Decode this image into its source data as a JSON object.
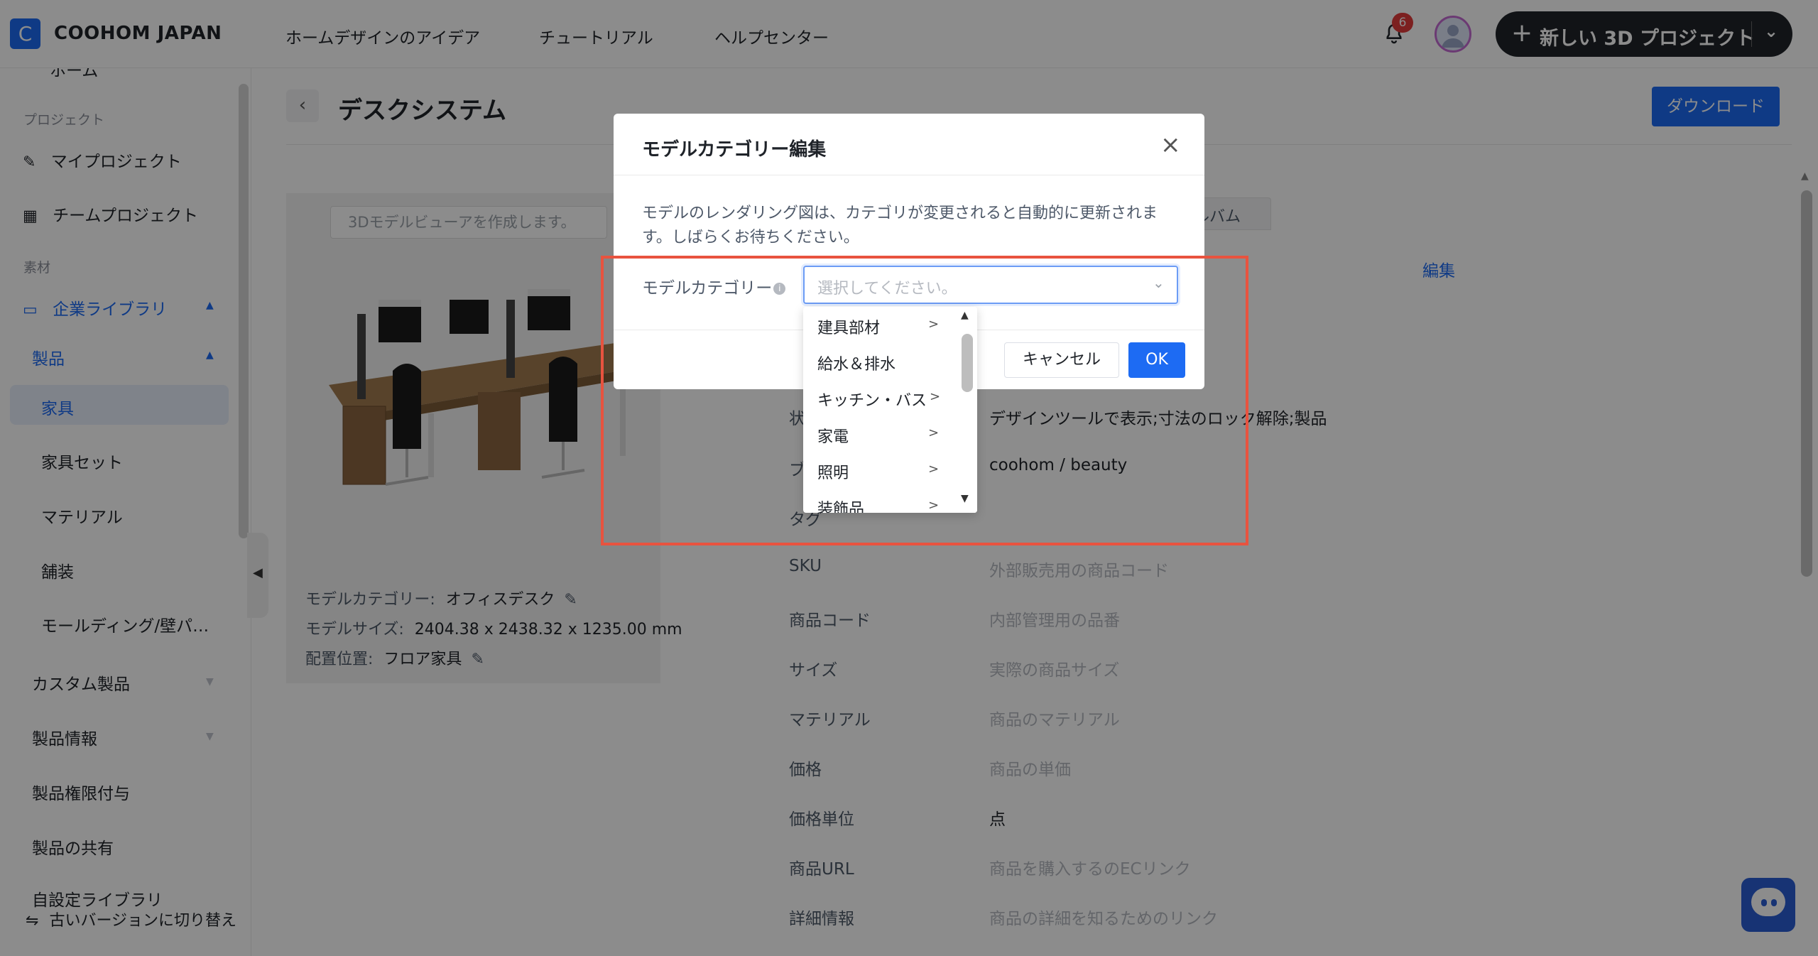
{
  "header": {
    "brand": "COOHOM JAPAN",
    "logo_letter": "C",
    "nav": [
      "ホームデザインのアイデア",
      "チュートリアル",
      "ヘルプセンター"
    ],
    "notification_count": "6",
    "new_project_label": "新しい 3D プロジェクト"
  },
  "sidebar": {
    "partial_top": "ホーム",
    "section_project": "プロジェクト",
    "my_projects": "マイプロジェクト",
    "team_projects": "チームプロジェクト",
    "section_material": "素材",
    "enterprise_library": "企業ライブラリ",
    "products": "製品",
    "furniture": "家具",
    "furniture_set": "家具セット",
    "material": "マテリアル",
    "flooring": "舗装",
    "molding": "モールディング/壁パ…",
    "custom_products": "カスタム製品",
    "product_info": "製品情報",
    "product_permission": "製品権限付与",
    "product_share": "製品の共有",
    "partial_bottom": "自設定ライブラリ",
    "switch_old": "古いバージョンに切り替え"
  },
  "page": {
    "title": "デスクシステム",
    "download": "ダウンロード",
    "viewer_placeholder": "3Dモデルビューアを作成します。",
    "meta": {
      "category_label": "モデルカテゴリー:",
      "category_value": "オフィスデスク",
      "size_label": "モデルサイズ:",
      "size_value": "2404.38 x 2438.32 x 1235.00 mm",
      "placement_label": "配置位置:",
      "placement_value": "フロア家具"
    },
    "tab_album": "ルバム",
    "edit": "編集",
    "rows": [
      {
        "label": "状",
        "value": "デザインツールで表示;寸法のロック解除;製品",
        "placeholder": false
      },
      {
        "label": "ブ",
        "value": "coohom / beauty",
        "placeholder": false
      },
      {
        "label": "タグ",
        "value": "",
        "placeholder": false
      },
      {
        "label": "SKU",
        "value": "外部販売用の商品コード",
        "placeholder": true
      },
      {
        "label": "商品コード",
        "value": "内部管理用の品番",
        "placeholder": true
      },
      {
        "label": "サイズ",
        "value": "実際の商品サイズ",
        "placeholder": true
      },
      {
        "label": "マテリアル",
        "value": "商品のマテリアル",
        "placeholder": true
      },
      {
        "label": "価格",
        "value": "商品の単価",
        "placeholder": true
      },
      {
        "label": "価格単位",
        "value": "点",
        "placeholder": false
      },
      {
        "label": "商品URL",
        "value": "商品を購入するのECリンク",
        "placeholder": true
      },
      {
        "label": "詳細情報",
        "value": "商品の詳細を知るためのリンク",
        "placeholder": true
      }
    ]
  },
  "modal": {
    "title": "モデルカテゴリー編集",
    "description": "モデルのレンダリング図は、カテゴリが変更されると自動的に更新されます。しばらくお待ちください。",
    "field_label": "モデルカテゴリー",
    "select_placeholder": "選択してください。",
    "cancel": "キャンセル",
    "ok": "OK",
    "options": [
      {
        "label": "建具部材",
        "has_children": true
      },
      {
        "label": "給水＆排水",
        "has_children": false
      },
      {
        "label": "キッチン・バス",
        "has_children": true
      },
      {
        "label": "家電",
        "has_children": true
      },
      {
        "label": "照明",
        "has_children": true
      },
      {
        "label": "装飾品",
        "has_children": true
      }
    ]
  },
  "colors": {
    "accent": "#1d6bf3",
    "highlight": "#e8533f",
    "dark_button": "#1f2329"
  }
}
